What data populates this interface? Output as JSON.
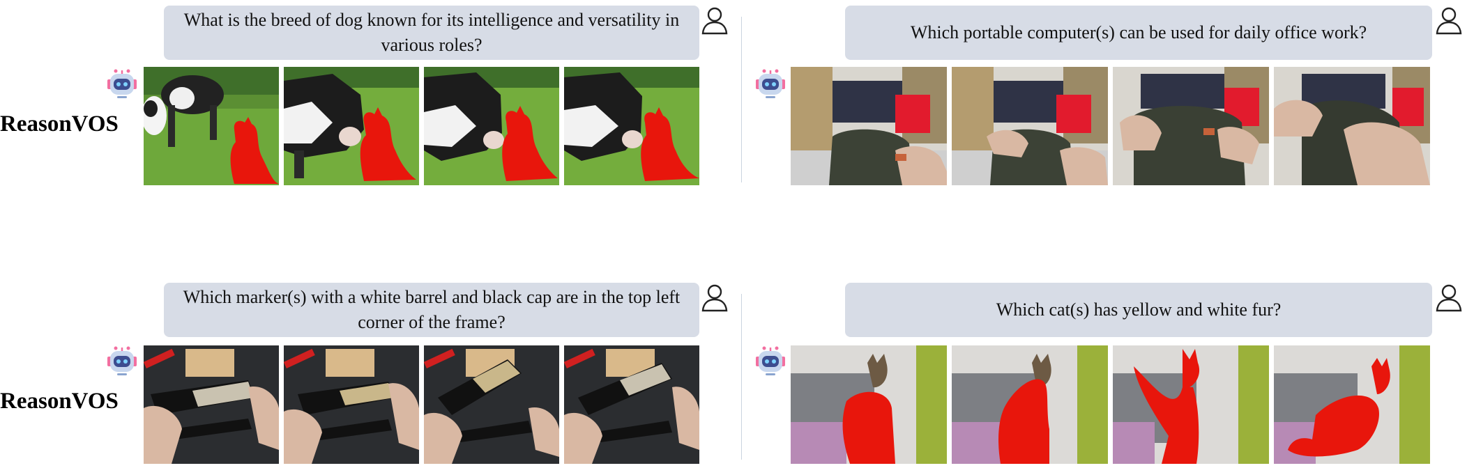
{
  "panels": [
    {
      "question": "What is the breed of dog known for its intelligence and versatility in various roles?",
      "label": "ReasonVOS",
      "scene": "cow-dog",
      "frames": 4
    },
    {
      "question": "Which portable computer(s) can be used for daily office work?",
      "label": "",
      "scene": "bag",
      "frames": 4
    },
    {
      "question": "Which marker(s) with a white barrel and black cap are in the top left corner of the frame?",
      "label": "ReasonVOS",
      "scene": "markers",
      "frames": 4
    },
    {
      "question": "Which cat(s) has yellow and white fur?",
      "label": "",
      "scene": "cat",
      "frames": 4
    }
  ],
  "icons": {
    "user": "user-outline-icon",
    "robot": "robot-icon"
  },
  "colors": {
    "question_bg": "#d7dce6",
    "mask": "#e8160c"
  }
}
